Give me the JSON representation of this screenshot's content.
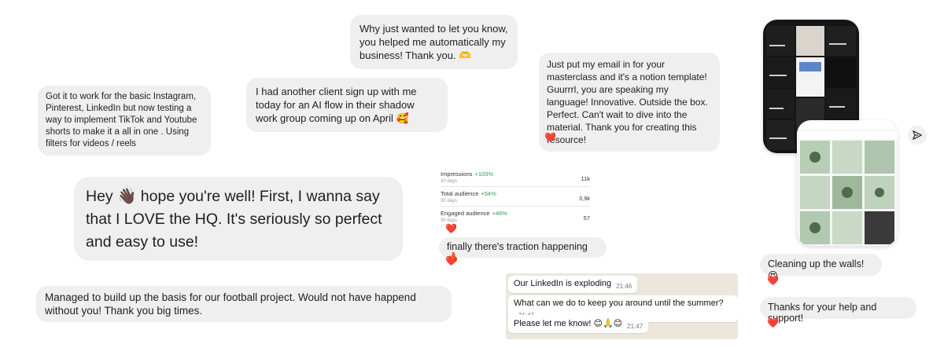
{
  "messages": {
    "automation": "Why just wanted to let you know, you helped me automatically my business! Thank you. 🫶",
    "basic_instagram": "Got it to work for the basic Instagram, Pinterest, LinkedIn but now testing a way to implement TikTok and Youtube shorts to make it a all in one . Using filters for videos / reels",
    "client_signup": "I had another client sign up with me today for an AI flow in their shadow work group coming up on April 🥰",
    "masterclass": "Just put my email in for your masterclass and it's a notion template! Guurrrl, you are speaking my language! Innovative. Outside the box. Perfect. Can't wait to dive into the material. Thank you for creating this resource!",
    "hey": "Hey 👋🏿  hope you're well! First, I wanna say that I LOVE the HQ. It's seriously so perfect and easy to use!",
    "traction": "finally there's traction happening🔥",
    "football": "Managed to build up the basis for our football project. Would not have happend without you! Thank you big times.",
    "walls": "Cleaning up the walls! 😍",
    "thanks_support": "Thanks for your help and support!"
  },
  "heart_icon": "❤️",
  "stats": [
    {
      "label": "Impressions",
      "change": "+103%",
      "period": "30 days",
      "value": "11k"
    },
    {
      "label": "Total audience",
      "change": "+54%",
      "period": "30 days",
      "value": "3,9k"
    },
    {
      "label": "Engaged audience",
      "change": "+46%",
      "period": "30 days",
      "value": "57"
    }
  ],
  "whatsapp": [
    {
      "text": "Our LinkedIn is exploding",
      "time": "21:46"
    },
    {
      "text": "What can we do to keep you around until the summer?",
      "time": "21:47"
    },
    {
      "text": "Please let me know! 😊🙏😊",
      "time": "21:47"
    }
  ],
  "icons": {
    "send": "send-icon"
  },
  "colors": {
    "bubble": "#efefef",
    "heart": "#e0142b",
    "wa_bg": "#ece6dc",
    "stat_up": "#2e9d57"
  }
}
